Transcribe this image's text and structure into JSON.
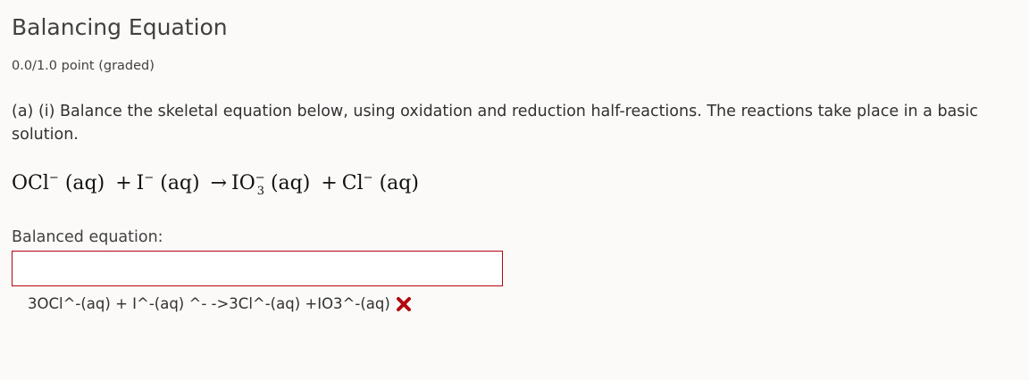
{
  "problem": {
    "title": "Balancing Equation",
    "points": "0.0/1.0 point (graded)",
    "prompt": "(a) (i) Balance the skeletal equation below, using oxidation and reduction half-reactions. The reactions take place in a basic solution.",
    "equation": {
      "reactant1": "OCl",
      "reactant1_charge": "−",
      "reactant1_state": "(aq)",
      "plus1": "+",
      "reactant2": "I",
      "reactant2_charge": "−",
      "reactant2_state": "(aq)",
      "arrow": "→",
      "product1": "IO",
      "product1_charge": "−",
      "product1_subscript": "3",
      "product1_state": "(aq)",
      "plus2": "+",
      "product2": "Cl",
      "product2_charge": "−",
      "product2_state": "(aq)"
    },
    "answer_label": "Balanced equation:",
    "answer_value": "",
    "preview_text": "3OCl^-(aq) + I^-(aq) ^- ->3Cl^-(aq) +IO3^-(aq)",
    "status": "incorrect",
    "status_icon": "cross-icon",
    "status_color": "#b20610"
  }
}
